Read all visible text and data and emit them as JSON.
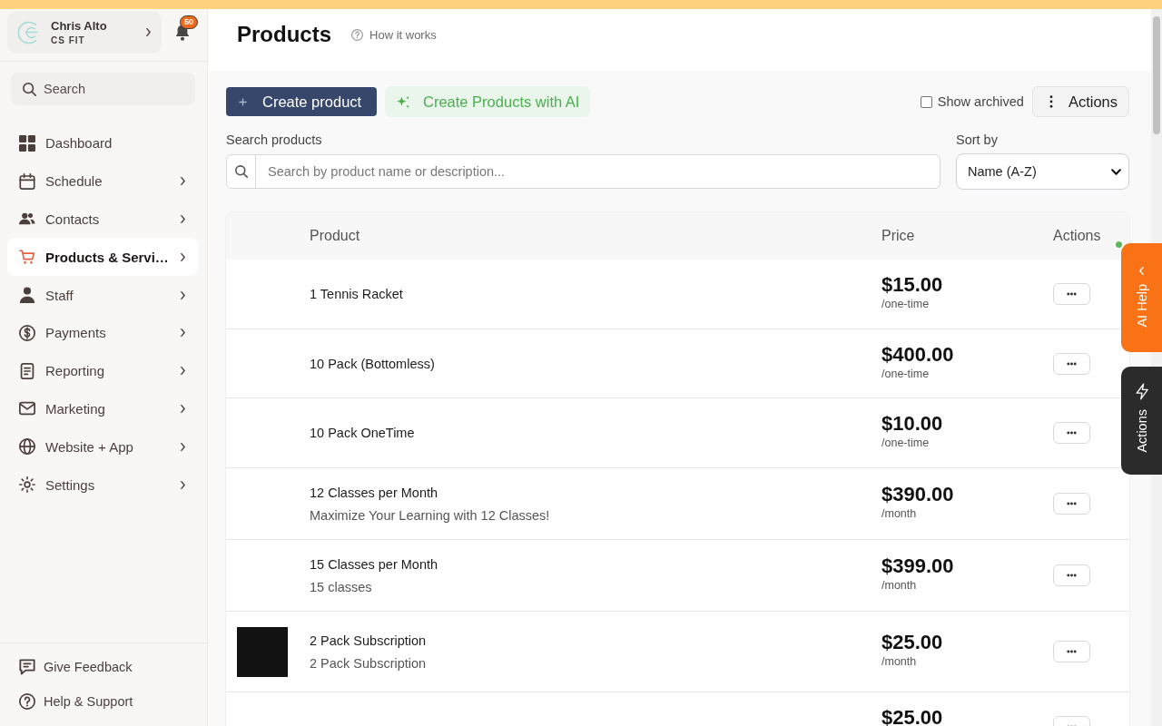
{
  "account": {
    "name": "Chris Alto",
    "organization": "CS FIT"
  },
  "notifications": {
    "badge": "50"
  },
  "sidebar": {
    "search": {
      "placeholder": "Search"
    },
    "items": [
      {
        "label": "Dashboard",
        "expandable": false,
        "selected": false
      },
      {
        "label": "Schedule",
        "expandable": true,
        "selected": false
      },
      {
        "label": "Contacts",
        "expandable": true,
        "selected": false
      },
      {
        "label": "Products & Servi…",
        "expandable": true,
        "selected": true
      },
      {
        "label": "Staff",
        "expandable": true,
        "selected": false
      },
      {
        "label": "Payments",
        "expandable": true,
        "selected": false
      },
      {
        "label": "Reporting",
        "expandable": true,
        "selected": false
      },
      {
        "label": "Marketing",
        "expandable": true,
        "selected": false
      },
      {
        "label": "Website + App",
        "expandable": true,
        "selected": false
      },
      {
        "label": "Settings",
        "expandable": true,
        "selected": false
      }
    ],
    "footer": [
      {
        "label": "Give Feedback"
      },
      {
        "label": "Help & Support"
      }
    ]
  },
  "page": {
    "title": "Products",
    "help_link": "How it works"
  },
  "toolbar": {
    "create_button": "Create product",
    "ai_button": "Create Products with AI",
    "show_archived": {
      "label": "Show archived",
      "checked": false
    },
    "actions_button": "Actions"
  },
  "filters": {
    "search": {
      "label": "Search products",
      "placeholder": "Search by product name or description..."
    },
    "sort": {
      "label": "Sort by",
      "value": "Name (A-Z)"
    }
  },
  "table": {
    "columns": [
      "Product",
      "Price",
      "Actions"
    ],
    "rows": [
      {
        "name": "1 Tennis Racket",
        "price": "$15.00",
        "period": "/one-time",
        "has_image": false
      },
      {
        "name": "10 Pack (Bottomless)",
        "price": "$400.00",
        "period": "/one-time",
        "has_image": false
      },
      {
        "name": "10 Pack OneTime",
        "price": "$10.00",
        "period": "/one-time",
        "has_image": false
      },
      {
        "name": "12 Classes per Month",
        "description": "Maximize Your Learning with 12 Classes!",
        "price": "$390.00",
        "period": "/month",
        "has_image": false
      },
      {
        "name": "15 Classes per Month",
        "description": "15 classes",
        "price": "$399.00",
        "period": "/month",
        "has_image": false
      },
      {
        "name": "2 Pack Subscription",
        "description": "2 Pack Subscription",
        "price": "$25.00",
        "period": "/month",
        "has_image": true
      },
      {
        "price": "$25.00",
        "has_image": false
      }
    ]
  },
  "side_tabs": [
    {
      "label": "AI Help",
      "kind": "ai-help"
    },
    {
      "label": "Actions",
      "kind": "actions"
    }
  ]
}
